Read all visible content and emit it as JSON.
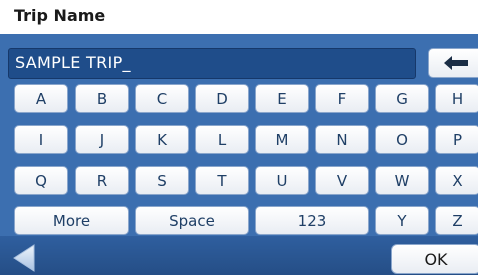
{
  "header": {
    "title": "Trip Name"
  },
  "entry": {
    "value": "SAMPLE TRIP_"
  },
  "keyboard": {
    "row1": [
      "A",
      "B",
      "C",
      "D",
      "E",
      "F",
      "G",
      "H"
    ],
    "row2": [
      "I",
      "J",
      "K",
      "L",
      "M",
      "N",
      "O",
      "P"
    ],
    "row3": [
      "Q",
      "R",
      "S",
      "T",
      "U",
      "V",
      "W",
      "X"
    ],
    "row4": {
      "more": "More",
      "space": "Space",
      "num": "123",
      "y": "Y",
      "z": "Z"
    }
  },
  "footer": {
    "ok": "OK"
  },
  "icons": {
    "backspace": "left-arrow-icon",
    "back": "back-triangle-icon"
  },
  "colors": {
    "panel": "#3c6fb0",
    "key_text": "#1f3f66"
  }
}
